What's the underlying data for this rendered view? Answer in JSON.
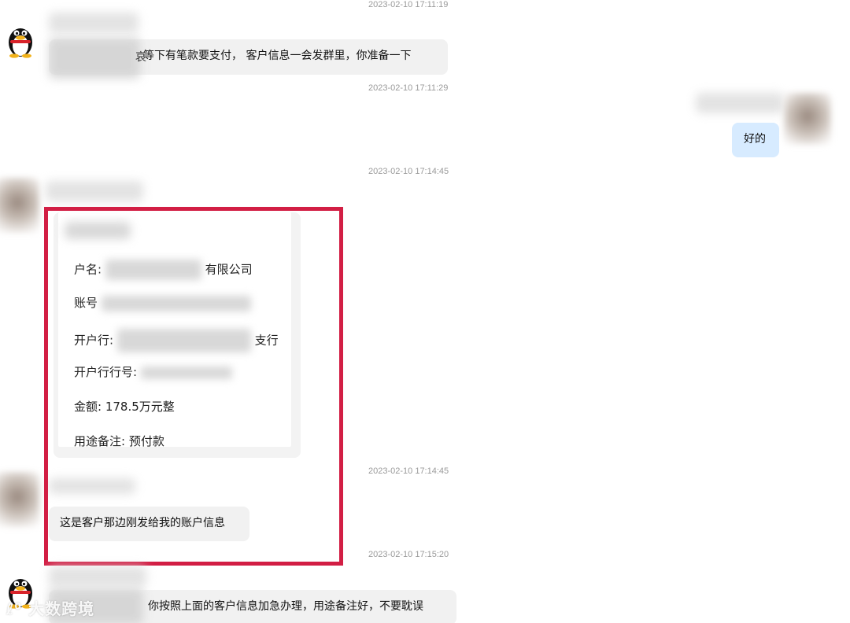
{
  "timestamps": {
    "t1": "2023-02-10 17:11:19",
    "t2": "2023-02-10 17:11:29",
    "t3": "2023-02-10 17:14:45",
    "t4": "2023-02-10 17:14:45",
    "t5": "2023-02-10 17:15:20"
  },
  "messages": {
    "m1_text": "等下有笔款要支付， 客户信息一会发群里，你准备一下",
    "m1_prefix": "哀",
    "m2_text": "好的",
    "m4_text": "这是客户那边刚发给我的账户信息",
    "m5_text": "你按照上面的客户信息加急办理，用途备注好，不要耽误"
  },
  "card": {
    "account_name_label": "户名:",
    "account_name_suffix": "有限公司",
    "account_no_label": "账号",
    "bank_label": "开户行:",
    "bank_suffix": "支行",
    "bank_no_label": "开户行行号:",
    "amount_label": "金额:",
    "amount_value": "178.5万元整",
    "purpose_label": "用途备注:",
    "purpose_value": "预付款"
  },
  "watermark": {
    "text": "大数跨境"
  },
  "colors": {
    "highlight": "#d21e44",
    "my_bubble": "#d7ebff",
    "other_bubble": "#f1f1f1"
  }
}
